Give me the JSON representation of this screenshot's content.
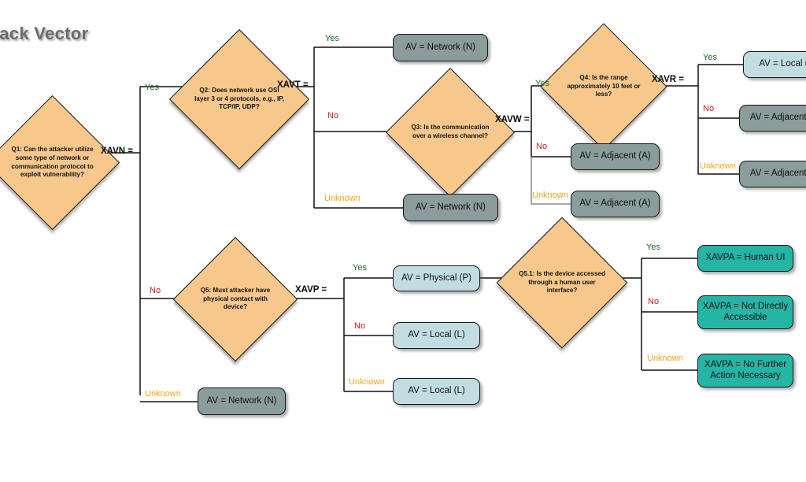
{
  "diagram": {
    "title": "ttack Vector",
    "type": "decision-flowchart",
    "subject": "Attack Vector (CVSS) decision tree",
    "colors": {
      "decision_fill": "#f7c78b",
      "network_fill": "#8b9c9c",
      "local_fill": "#c2dde2",
      "xavpa_fill": "#25b5a5",
      "yes_label": "#1d6b2a",
      "no_label": "#c41f1f",
      "unknown_label": "#f0a71c",
      "title_text": "#6b6b6b",
      "edge": "#111111"
    }
  },
  "decisions": {
    "q1": "Q1: Can the attacker utilize some type of network or communication protocol to exploit vulnerability?",
    "q2": "Q2: Does network use OSI layer 3 or 4 protocols, e.g., IP, TCP/IP, UDP?",
    "q3": "Q3: Is the communication over a wireless channel?",
    "q4": "Q4: Is the range approximately  10 feet or less?",
    "q5": "Q5: Must attacker have physical contact with device?",
    "q51": "Q5.1: Is the device accessed through a human user interface?"
  },
  "variables": {
    "xavn": "XAVN =",
    "xavt": "XAVT =",
    "xavw": "XAVW =",
    "xavr": "XAVR =",
    "xavp": "XAVP =",
    "xavpa": "XAVPA"
  },
  "branch_labels": {
    "yes": "Yes",
    "no": "No",
    "unknown": "Unknown"
  },
  "outcomes": {
    "network_q2_yes": "AV = Network (N)",
    "network_q2_unknown": "AV = Network (N)",
    "network_q1_unknown": "AV = Network (N)",
    "local_q4_yes": "AV = Local (L)",
    "adjacent_q4_no": "AV = Adjacent (A)",
    "adjacent_q4_unknown": "AV = Adjacent (A)",
    "adjacent_q3_no": "AV = Adjacent (A)",
    "adjacent_q3_unknown": "AV = Adjacent (A)",
    "physical_q5_yes": "AV = Physical (P)",
    "local_q5_no": "AV = Local (L)",
    "local_q5_unknown": "AV = Local (L)",
    "xavpa_yes": "XAVPA = Human UI",
    "xavpa_no": "XAVPA = Not Directly Accessible",
    "xavpa_unknown": "XAVPA = No Further Action Necessary"
  },
  "edges": [
    {
      "from": "q1",
      "label": "Yes",
      "to": "q2"
    },
    {
      "from": "q1",
      "label": "No",
      "to": "q5"
    },
    {
      "from": "q1",
      "label": "Unknown",
      "to": "network_q1_unknown"
    },
    {
      "from": "q2",
      "label": "Yes",
      "to": "network_q2_yes"
    },
    {
      "from": "q2",
      "label": "No",
      "to": "q3"
    },
    {
      "from": "q2",
      "label": "Unknown",
      "to": "network_q2_unknown"
    },
    {
      "from": "q3",
      "label": "Yes",
      "to": "q4"
    },
    {
      "from": "q3",
      "label": "No",
      "to": "adjacent_q3_no"
    },
    {
      "from": "q3",
      "label": "Unknown",
      "to": "adjacent_q3_unknown"
    },
    {
      "from": "q4",
      "label": "Yes",
      "to": "local_q4_yes"
    },
    {
      "from": "q4",
      "label": "No",
      "to": "adjacent_q4_no"
    },
    {
      "from": "q4",
      "label": "Unknown",
      "to": "adjacent_q4_unknown"
    },
    {
      "from": "q5",
      "label": "Yes",
      "to": "physical_q5_yes"
    },
    {
      "from": "q5",
      "label": "No",
      "to": "local_q5_no"
    },
    {
      "from": "q5",
      "label": "Unknown",
      "to": "local_q5_unknown"
    },
    {
      "from": "physical_q5_yes",
      "label": "",
      "to": "q51"
    },
    {
      "from": "q51",
      "label": "Yes",
      "to": "xavpa_yes"
    },
    {
      "from": "q51",
      "label": "No",
      "to": "xavpa_no"
    },
    {
      "from": "q51",
      "label": "Unknown",
      "to": "xavpa_unknown"
    }
  ]
}
